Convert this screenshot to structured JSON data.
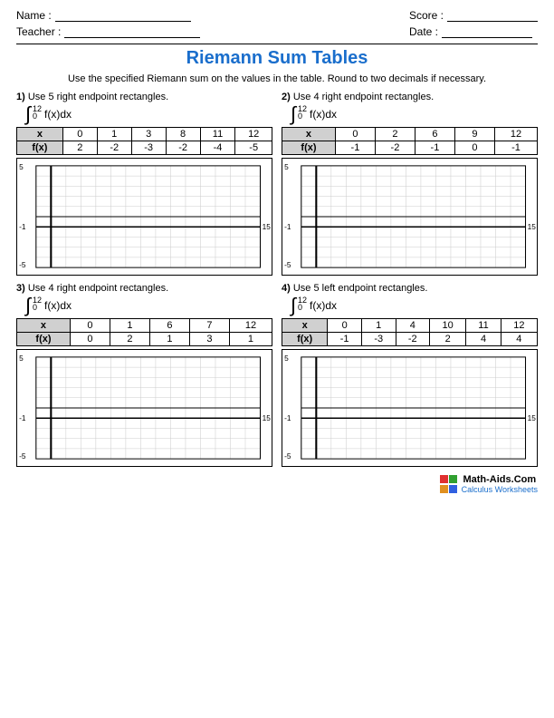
{
  "header": {
    "name_label": "Name :",
    "teacher_label": "Teacher :",
    "score_label": "Score :",
    "date_label": "Date :"
  },
  "title": "Riemann Sum Tables",
  "instructions": "Use the specified Riemann sum on the values in the table. Round to two decimals if necessary.",
  "problems": [
    {
      "number": "1)",
      "description": "Use 5 right endpoint rectangles.",
      "integral_upper": "12",
      "integral_lower": "0",
      "integral_expr": "f(x)dx",
      "x_values": [
        "x",
        "0",
        "1",
        "3",
        "8",
        "11",
        "12"
      ],
      "fx_values": [
        "f(x)",
        "2",
        "-2",
        "-3",
        "-2",
        "-4",
        "-5"
      ]
    },
    {
      "number": "2)",
      "description": "Use 4 right endpoint rectangles.",
      "integral_upper": "12",
      "integral_lower": "0",
      "integral_expr": "f(x)dx",
      "x_values": [
        "x",
        "0",
        "2",
        "6",
        "9",
        "12"
      ],
      "fx_values": [
        "f(x)",
        "-1",
        "-2",
        "-1",
        "0",
        "-1"
      ]
    },
    {
      "number": "3)",
      "description": "Use 4 right endpoint rectangles.",
      "integral_upper": "12",
      "integral_lower": "0",
      "integral_expr": "f(x)dx",
      "x_values": [
        "x",
        "0",
        "1",
        "6",
        "7",
        "12"
      ],
      "fx_values": [
        "f(x)",
        "0",
        "2",
        "1",
        "3",
        "1"
      ]
    },
    {
      "number": "4)",
      "description": "Use 5 left endpoint rectangles.",
      "integral_upper": "12",
      "integral_lower": "0",
      "integral_expr": "f(x)dx",
      "x_values": [
        "x",
        "0",
        "1",
        "4",
        "10",
        "11",
        "12"
      ],
      "fx_values": [
        "f(x)",
        "-1",
        "-3",
        "-2",
        "2",
        "4",
        "4"
      ]
    }
  ],
  "graph": {
    "y_top": "5",
    "y_bottom": "-5",
    "y_axis_label": "-1",
    "x_right": "15"
  },
  "footer": {
    "site_name": "Math-Aids.Com",
    "site_sub": "Calculus Worksheets"
  }
}
